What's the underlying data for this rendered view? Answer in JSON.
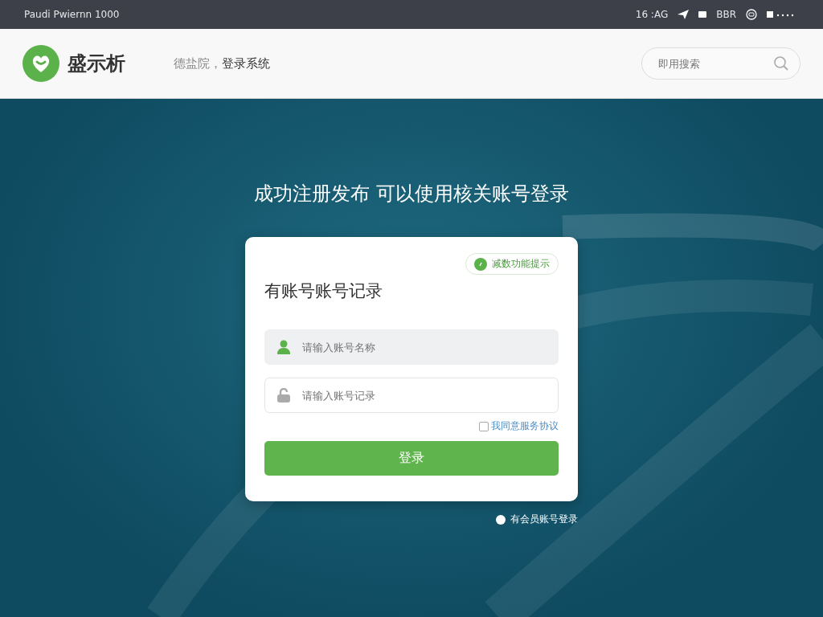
{
  "status_bar": {
    "left": "Paudi Pwiernn  1000",
    "time": "16 :AG",
    "items": [
      "BBR"
    ]
  },
  "header": {
    "logo": "盛示析",
    "subtitle_light": "德盐院，",
    "subtitle": "登录系统",
    "search": {
      "placeholder": "即用搜索"
    }
  },
  "banner": {
    "title": "成功注册发布 可以使用核关账号登录"
  },
  "card": {
    "pill": "减数功能提示",
    "heading": "有账号账号记录",
    "fields": [
      {
        "kind": "user",
        "placeholder": "请输入账号名称",
        "filled": true
      },
      {
        "kind": "lock",
        "placeholder": "请输入账号记录",
        "filled": false
      }
    ],
    "agree": {
      "label": "我同意服务协议",
      "checked": false
    },
    "submit": "登录"
  },
  "footer_link": {
    "label": "有会员账号登录"
  }
}
